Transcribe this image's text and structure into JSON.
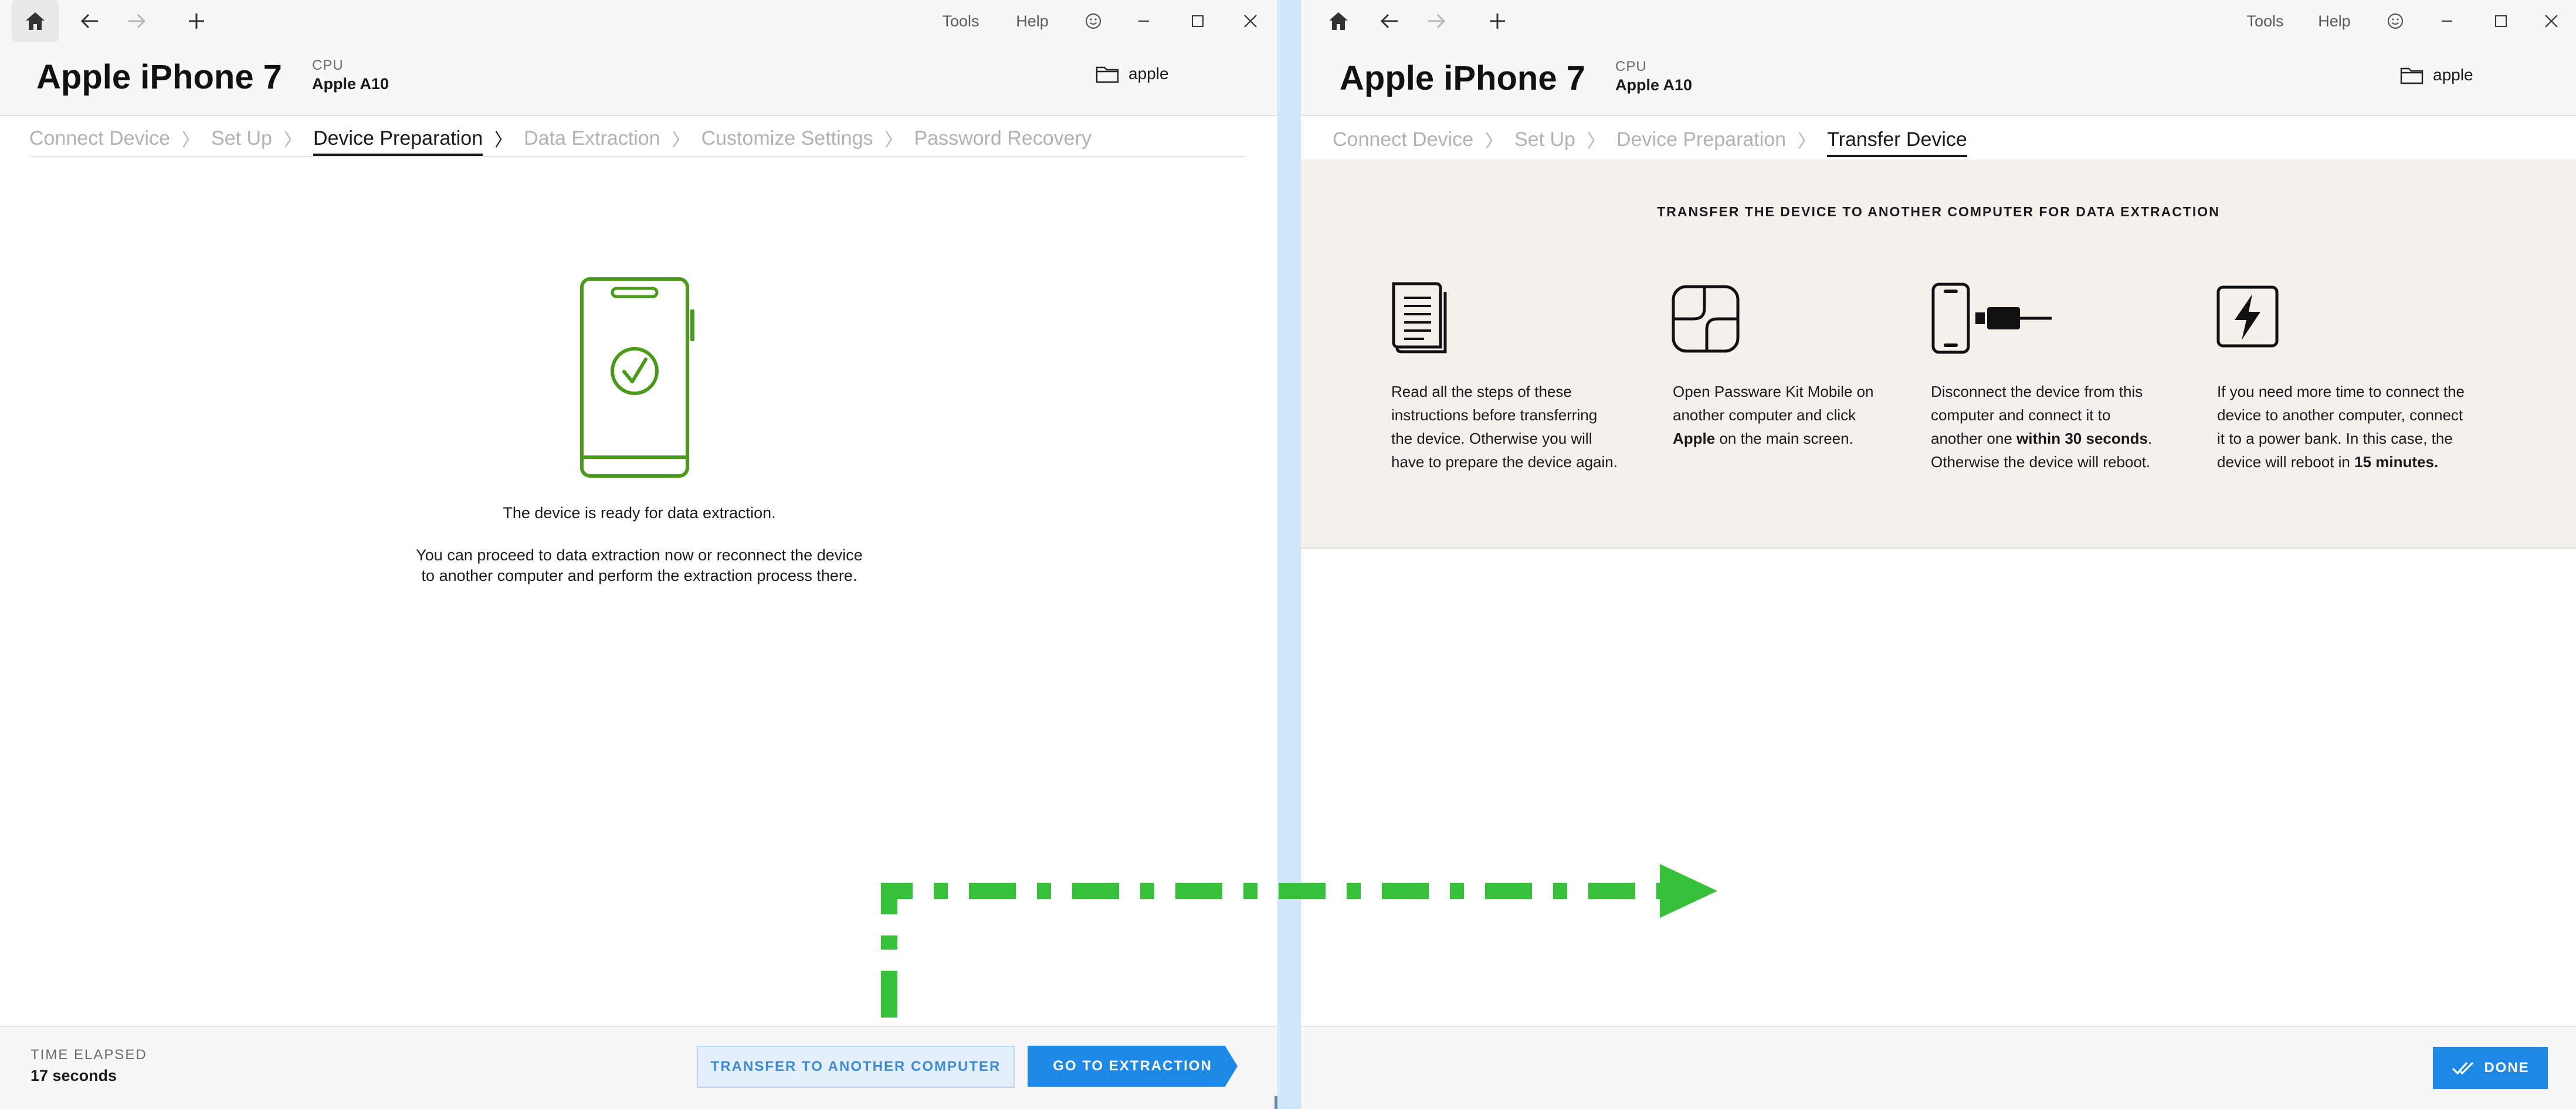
{
  "left_window": {
    "titlebar": {
      "tools": "Tools",
      "help": "Help"
    },
    "header": {
      "device_name": "Apple iPhone 7",
      "cpu_label": "CPU",
      "cpu_value": "Apple A10",
      "folder": "apple"
    },
    "breadcrumb": [
      {
        "label": "Connect Device",
        "state": "done"
      },
      {
        "label": "Set Up",
        "state": "done"
      },
      {
        "label": "Device Preparation",
        "state": "active"
      },
      {
        "label": "Data Extraction",
        "state": "pending"
      },
      {
        "label": "Customize Settings",
        "state": "pending"
      },
      {
        "label": "Password Recovery",
        "state": "pending"
      }
    ],
    "main": {
      "ready_text": "The device is ready for data extraction.",
      "info_line1": "You can proceed to data extraction now or reconnect the device",
      "info_line2": "to another computer and perform the extraction process there."
    },
    "footer": {
      "elapsed_label": "TIME ELAPSED",
      "elapsed_value": "17 seconds",
      "transfer_button": "TRANSFER TO ANOTHER COMPUTER",
      "extraction_button": "GO TO EXTRACTION"
    }
  },
  "right_window": {
    "titlebar": {
      "tools": "Tools",
      "help": "Help"
    },
    "header": {
      "device_name": "Apple iPhone 7",
      "cpu_label": "CPU",
      "cpu_value": "Apple A10",
      "folder": "apple"
    },
    "breadcrumb": [
      {
        "label": "Connect Device",
        "state": "done"
      },
      {
        "label": "Set Up",
        "state": "done"
      },
      {
        "label": "Device Preparation",
        "state": "done"
      },
      {
        "label": "Transfer Device",
        "state": "active"
      }
    ],
    "panel": {
      "title": "TRANSFER THE DEVICE TO ANOTHER COMPUTER FOR DATA EXTRACTION",
      "steps": [
        {
          "icon": "document-icon",
          "lines": [
            "Read all the steps of these",
            "instructions before transferring",
            "the device. Otherwise you will",
            "have to prepare the device again."
          ]
        },
        {
          "icon": "passware-logo-icon",
          "lines": [
            "Open Passware Kit Mobile on",
            "another computer and click",
            "Apple",
            "on the main screen."
          ]
        },
        {
          "icon": "phone-cable-icon",
          "lines": [
            "Disconnect the device from this",
            "computer and connect it to",
            "another one",
            "within 30 seconds",
            ".",
            "Otherwise the device will reboot."
          ]
        },
        {
          "icon": "lightning-icon",
          "lines": [
            "If you need more time to connect the",
            "device to another computer, connect",
            "it to a power bank. In this case, the",
            "device will reboot in",
            "15 minutes."
          ]
        }
      ]
    },
    "footer": {
      "done_button": "DONE"
    }
  },
  "colors": {
    "accent_blue": "#1d88e5",
    "success_green": "#4a9a1a",
    "arrow_green": "#37c03a",
    "divider_blue": "#cfe6fb",
    "panel_beige": "#f3f1ec"
  }
}
